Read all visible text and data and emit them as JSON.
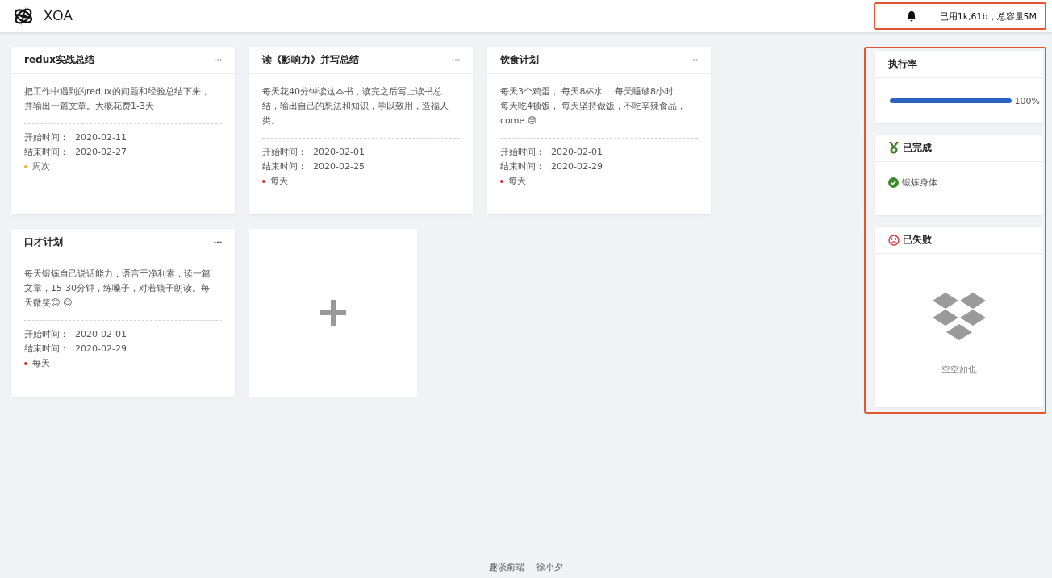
{
  "header": {
    "brand": "XOA",
    "storage": "已用1k,61b，总容量5M"
  },
  "plans": [
    {
      "title": "redux实战总结",
      "description": "把工作中遇到的redux的问题和经验总结下来，并输出一篇文章。大概花费1-3天",
      "start_label": "开始时间：",
      "start": "2020-02-11",
      "end_label": "结束时间：",
      "end": "2020-02-27",
      "frequency": "周次",
      "color": "#e8b04a"
    },
    {
      "title": "读《影响力》并写总结",
      "description": "每天花40分钟读这本书，读完之后写上读书总结，输出自己的想法和知识，学以致用，造福人类。",
      "start_label": "开始时间：",
      "start": "2020-02-01",
      "end_label": "结束时间：",
      "end": "2020-02-25",
      "frequency": "每天",
      "color": "#cc3333"
    },
    {
      "title": "饮食计划",
      "description": "每天3个鸡蛋， 每天8杯水， 每天睡够8小时，每天吃4顿饭， 每天坚持做饭，不吃辛辣食品，come 😓",
      "start_label": "开始时间：",
      "start": "2020-02-01",
      "end_label": "结束时间：",
      "end": "2020-02-29",
      "frequency": "每天",
      "color": "#cc3333"
    },
    {
      "title": "口才计划",
      "description": "每天锻炼自己说话能力，语言干净利索，读一篇文章，15-30分钟，练嗓子，对着镜子朗读。每天微笑😊 😊",
      "start_label": "开始时间：",
      "start": "2020-02-01",
      "end_label": "结束时间：",
      "end": "2020-02-29",
      "frequency": "每天",
      "color": "#cc3333"
    }
  ],
  "sidebar": {
    "rate": {
      "title": "执行率",
      "level": 1,
      "reading": "100%"
    },
    "done": {
      "title": "已完成",
      "items": [
        "锻炼身体"
      ]
    },
    "failed": {
      "title": "已失败",
      "empty_text": "空空如也"
    }
  },
  "footer": "趣谈前端 -- 徐小夕"
}
